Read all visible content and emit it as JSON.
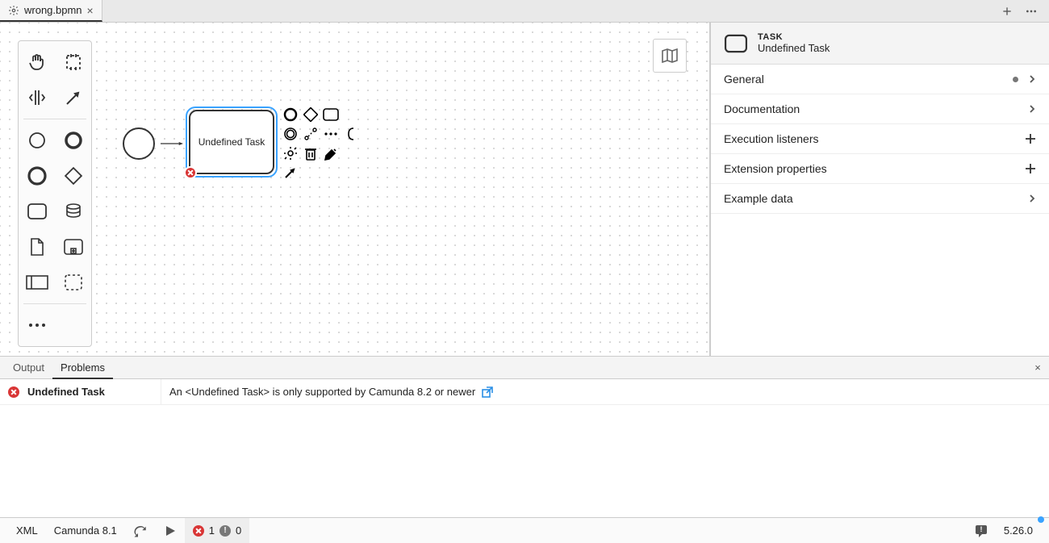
{
  "tabs": {
    "file_name": "wrong.bpmn"
  },
  "canvas": {
    "task_label": "Undefined Task"
  },
  "properties": {
    "type_label": "TASK",
    "name": "Undefined Task",
    "groups": {
      "general": "General",
      "documentation": "Documentation",
      "execution_listeners": "Execution listeners",
      "extension_properties": "Extension properties",
      "example_data": "Example data"
    }
  },
  "bottom": {
    "tab_output": "Output",
    "tab_problems": "Problems",
    "problem_element": "Undefined Task",
    "problem_message": "An <Undefined Task> is only supported by Camunda 8.2 or newer"
  },
  "status": {
    "xml": "XML",
    "engine": "Camunda 8.1",
    "error_count": "1",
    "warning_count": "0",
    "version": "5.26.0"
  }
}
